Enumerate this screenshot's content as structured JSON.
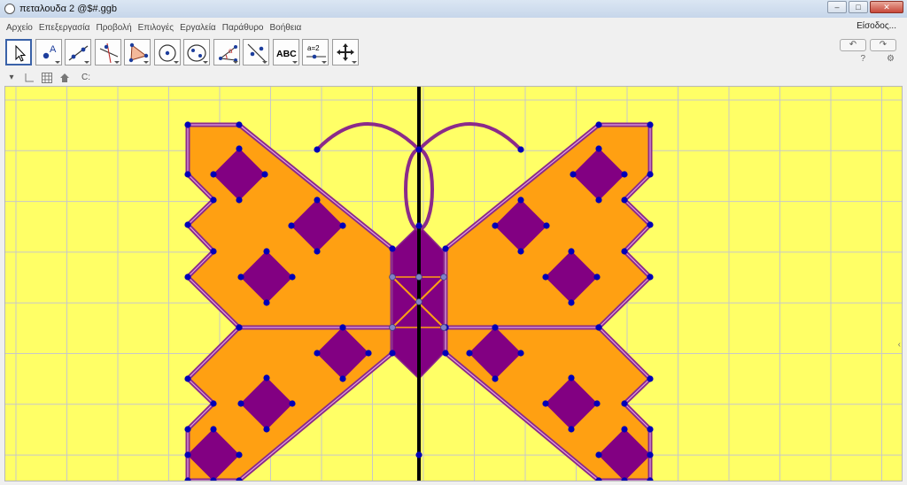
{
  "window": {
    "title": "πεταλουδα 2 @$#.ggb",
    "controls": [
      "‒",
      "□",
      "✕"
    ]
  },
  "menu": {
    "items": [
      "Αρχείο",
      "Επεξεργασία",
      "Προβολή",
      "Επιλογές",
      "Εργαλεία",
      "Παράθυρο",
      "Βοήθεια"
    ],
    "signin": "Είσοδος..."
  },
  "toolbar": {
    "tools": [
      {
        "name": "move-tool",
        "icon": "cursor-arrow-icon"
      },
      {
        "name": "point-tool",
        "icon": "point-icon",
        "label": "A"
      },
      {
        "name": "line-tool",
        "icon": "line-icon"
      },
      {
        "name": "perpendicular-tool",
        "icon": "perpendicular-icon"
      },
      {
        "name": "polygon-tool",
        "icon": "polygon-icon"
      },
      {
        "name": "circle-tool",
        "icon": "circle-center-icon"
      },
      {
        "name": "ellipse-tool",
        "icon": "ellipse-icon"
      },
      {
        "name": "angle-tool",
        "icon": "angle-icon",
        "label": "α"
      },
      {
        "name": "reflect-tool",
        "icon": "reflect-icon"
      },
      {
        "name": "text-tool",
        "icon": "text-icon",
        "label": "ABC"
      },
      {
        "name": "slider-tool",
        "icon": "slider-icon",
        "label": "a=2"
      },
      {
        "name": "move-view-tool",
        "icon": "move-graphics-icon"
      }
    ],
    "undo": "↶",
    "redo": "↷",
    "help": "?",
    "settings": "⚙"
  },
  "stylebar": {
    "items": [
      "▾",
      "axes-icon",
      "grid-icon",
      "home-icon",
      "C:"
    ]
  },
  "canvas": {
    "colors": {
      "background": "#ffff66",
      "grid": "#c8c8c8",
      "wing_fill": "#ffa012",
      "wing_stroke": "#8b2a8a",
      "diamond": "#820082",
      "point": "#0000b8",
      "axis": "#000000",
      "light_point": "#8080c8"
    }
  }
}
